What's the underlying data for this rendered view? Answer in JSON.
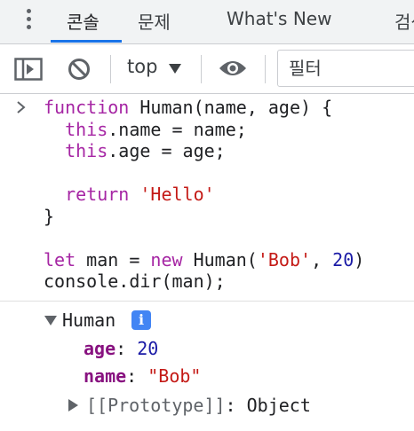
{
  "tabs": [
    {
      "label": "콘솔",
      "active": true
    },
    {
      "label": "문제",
      "active": false
    },
    {
      "label": "What's New",
      "active": false
    },
    {
      "label": "검색",
      "active": false
    }
  ],
  "toolbar": {
    "context": "top",
    "filter_placeholder": "필터"
  },
  "code": {
    "l1_kw": "function",
    "l1_rest": " Human(name, age) {",
    "l2_this": "this",
    "l2_rest": ".name = name;",
    "l3_this": "this",
    "l3_rest": ".age = age;",
    "l5_kw": "return",
    "l5_str": "'Hello'",
    "l6": "}",
    "l8_let": "let",
    "l8_a": " man = ",
    "l8_new": "new",
    "l8_b": " Human(",
    "l8_str": "'Bob'",
    "l8_c": ", ",
    "l8_num": "20",
    "l8_d": ")",
    "l9": "console.dir(man);"
  },
  "object": {
    "class_name": "Human",
    "info_glyph": "i",
    "props": [
      {
        "key": "age",
        "value": "20"
      },
      {
        "key": "name",
        "value": "\"Bob\""
      }
    ],
    "proto_key": "[[Prototype]]",
    "proto_value": "Object"
  },
  "colors": {
    "accent": "#1a73e8",
    "keyword": "#a626a4",
    "string": "#c41a16",
    "number": "#1a1aa6",
    "property": "#881280"
  }
}
